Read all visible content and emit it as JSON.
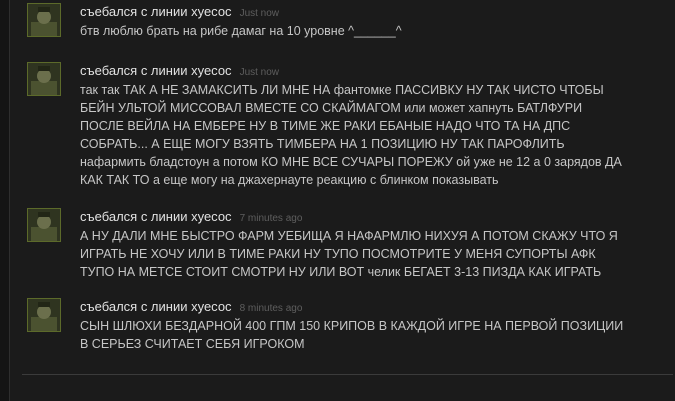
{
  "comments": [
    {
      "author": "съебался с линии хуесос",
      "time": "Just now",
      "lines": [
        "бтв люблю брать на рибе дамаг на 10 уровне ^______^"
      ]
    },
    {
      "author": "съебался с линии хуесос",
      "time": "Just now",
      "lines": [
        "так так ТАК А НЕ ЗАМАКСИТЬ ЛИ МНЕ НА фантомке ПАССИВКУ НУ ТАК ЧИСТО ЧТОБЫ",
        "БЕЙН УЛЬТОЙ МИССОВАЛ ВМЕСТЕ СО СКАЙМАГОМ или может хапнуть БАТЛФУРИ",
        "ПОСЛЕ ВЕЙЛА НА ЕМБЕРЕ НУ В ТИМЕ ЖЕ РАКИ ЕБАНЫЕ НАДО ЧТО ТА НА ДПС",
        "СОБРАТЬ... А ЕЩЕ МОГУ ВЗЯТЬ ТИМБЕРА НА 1 ПОЗИЦИЮ НУ ТАК ПАРОФЛИТЬ",
        "нафармить бладстоун а потом КО МНЕ ВСЕ СУЧАРЫ ПОРЕЖУ ой уже не 12 а 0 зарядов ДА",
        "КАК ТАК ТО а еще могу на джахернауте реакцию с блинком показывать"
      ]
    },
    {
      "author": "съебался с линии хуесос",
      "time": "7 minutes ago",
      "lines": [
        "А НУ ДАЛИ МНЕ БЫСТРО ФАРМ УЕБИЩА Я НАФАРМЛЮ НИХУЯ А ПОТОМ СКАЖУ ЧТО Я",
        "ИГРАТЬ НЕ ХОЧУ ИЛИ В ТИМЕ РАКИ НУ ТУПО ПОСМОТРИТЕ У МЕНЯ СУПОРТЫ АФК",
        "ТУПО НА МЕТСЕ СТОИТ СМОТРИ НУ ИЛИ ВОТ челик БЕГАЕТ 3-13 ПИЗДА КАК ИГРАТЬ"
      ]
    },
    {
      "author": "съебался с линии хуесос",
      "time": "8 minutes ago",
      "lines": [
        "СЫН ШЛЮХИ БЕЗДАРНОЙ 400 ГПМ 150 КРИПОВ В КАЖДОЙ ИГРЕ НА ПЕРВОЙ ПОЗИЦИИ",
        "В СЕРЬЕЗ СЧИТАЕТ СЕБЯ ИГРОКОМ"
      ]
    }
  ]
}
